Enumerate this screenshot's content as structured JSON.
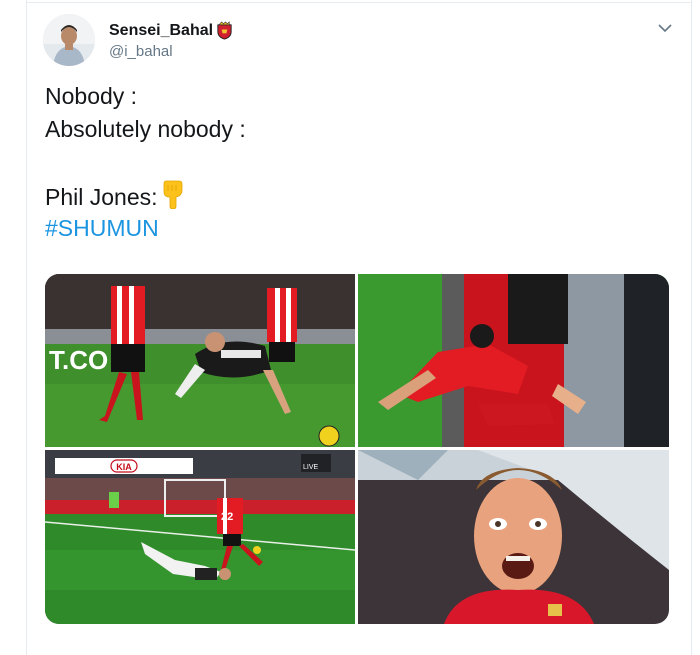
{
  "tweet": {
    "display_name": "Sensei_Bahal",
    "handle": "@i_bahal",
    "lines": [
      "Nobody :",
      "Absolutely nobody :",
      "",
      "Phil Jones:"
    ],
    "hashtag": "#SHUMUN",
    "emoji": "down-pointing-hand-emoji"
  },
  "media": {
    "tiles": [
      {
        "name": "photo-sheffield-fall",
        "overlay_text": "T.CO"
      },
      {
        "name": "photo-slide-closeup"
      },
      {
        "name": "photo-broadcast-replay",
        "sponsor_text": "KIA",
        "live_text": "LIVE",
        "shirt_number": "22"
      },
      {
        "name": "photo-shocked-face"
      }
    ]
  },
  "colors": {
    "hashtag": "#1b95e0",
    "text": "#14171a",
    "muted": "#657786",
    "pitch": "#2f8a2a",
    "kit_red": "#d8182a"
  }
}
